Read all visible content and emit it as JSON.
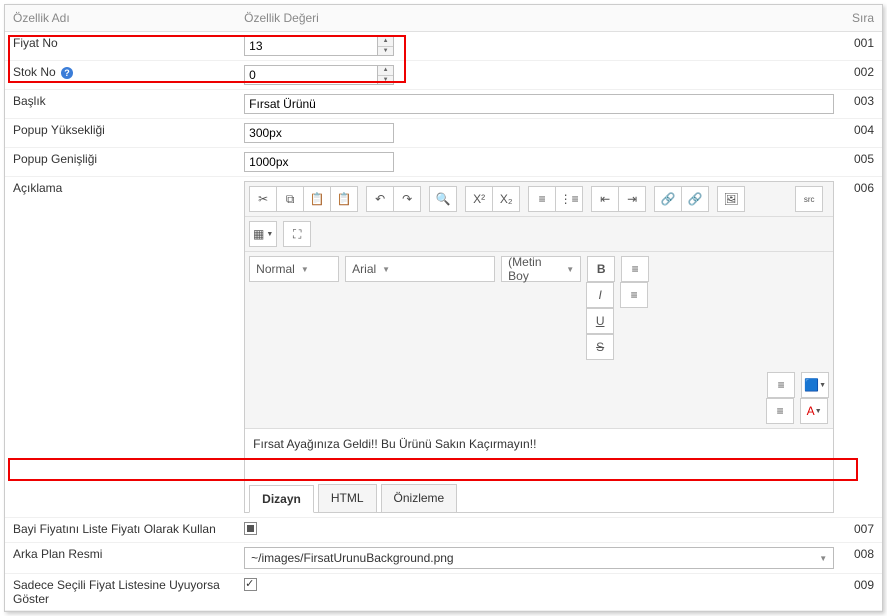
{
  "headers": {
    "name": "Özellik Adı",
    "value": "Özellik Değeri",
    "order": "Sıra"
  },
  "rows": {
    "r1": {
      "label": "Fiyat No",
      "value": "13",
      "order": "001"
    },
    "r2": {
      "label": "Stok No",
      "value": "0",
      "order": "002"
    },
    "r3": {
      "label": "Başlık",
      "value": "Fırsat Ürünü",
      "order": "003"
    },
    "r4": {
      "label": "Popup Yüksekliği",
      "value": "300px",
      "order": "004"
    },
    "r5": {
      "label": "Popup Genişliği",
      "value": "1000px",
      "order": "005"
    },
    "r6": {
      "label": "Açıklama",
      "order": "006"
    },
    "r7": {
      "label": "Bayi Fiyatını Liste Fiyatı Olarak Kullan",
      "order": "007"
    },
    "r8": {
      "label": "Arka Plan Resmi",
      "value": "~/images/FirsatUrunuBackground.png",
      "order": "008"
    },
    "r9": {
      "label": "Sadece Seçili Fiyat Listesine Uyuyorsa Göster",
      "order": "009"
    }
  },
  "editor": {
    "format": "Normal",
    "font": "Arial",
    "size_placeholder": "(Metin Boy",
    "content": "Fırsat Ayağınıza Geldi!! Bu Ürünü Sakın Kaçırmayın!!",
    "tabs": {
      "design": "Dizayn",
      "html": "HTML",
      "preview": "Önizleme"
    }
  }
}
